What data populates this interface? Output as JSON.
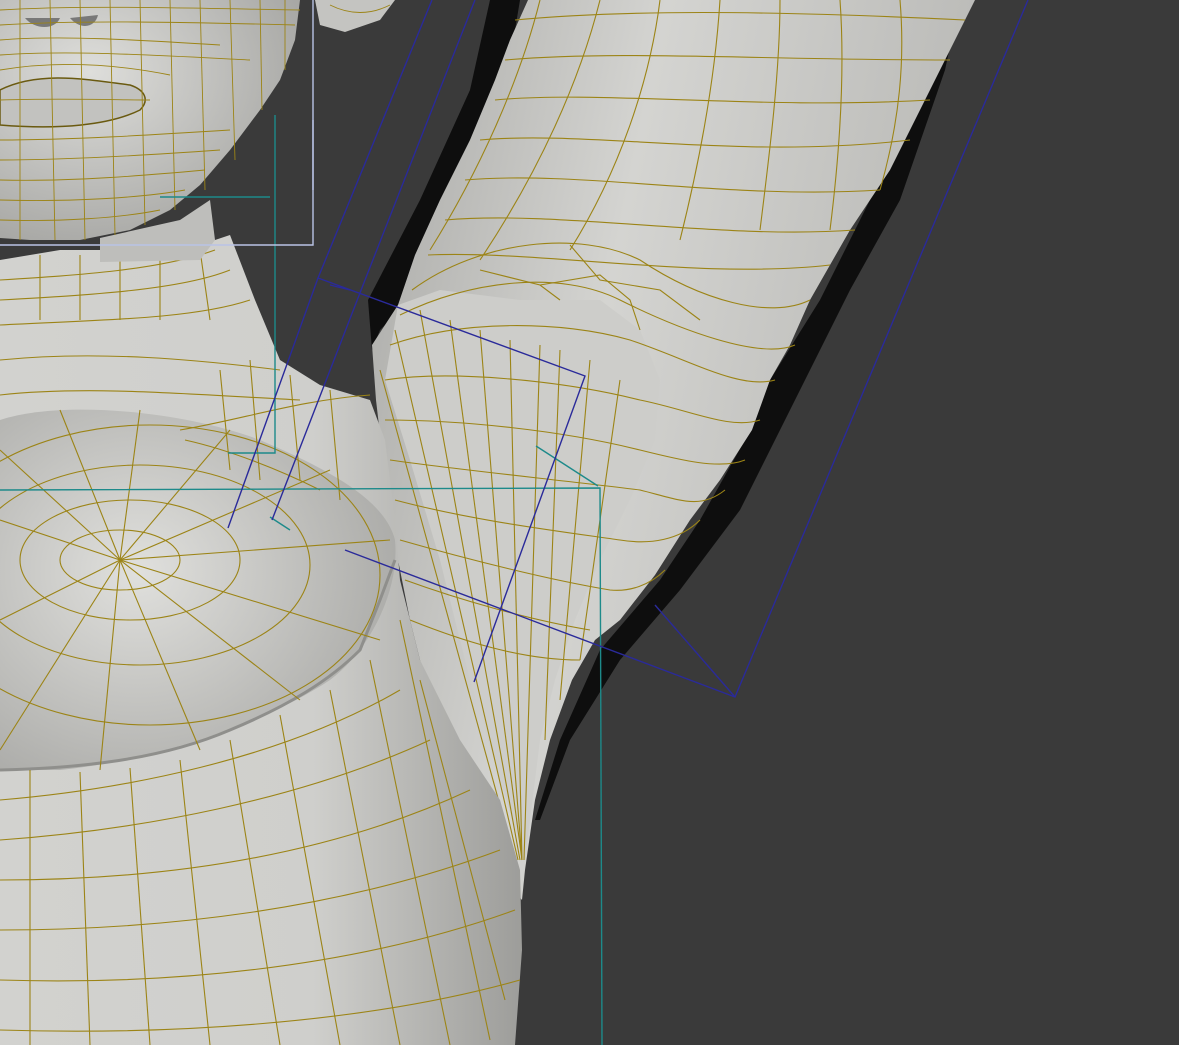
{
  "viewport": {
    "background": "#3a3a3a",
    "mesh_fill": "#c9c9c6",
    "mesh_shadow": "#9e9e9b",
    "mesh_highlight": "#e2e2df",
    "wire_color": "#9c8416",
    "bone_color": "#2a2a9a",
    "helper_color": "#1d8a8a",
    "selection_color": "#b9c3e6",
    "cast_shadow": "#0c0c0c"
  },
  "scene": {
    "objects": [
      "head-mesh",
      "torso-mesh",
      "arm-mesh",
      "shoulder-bone",
      "upper-arm-bone",
      "spine-helper-box",
      "selection-box"
    ]
  }
}
